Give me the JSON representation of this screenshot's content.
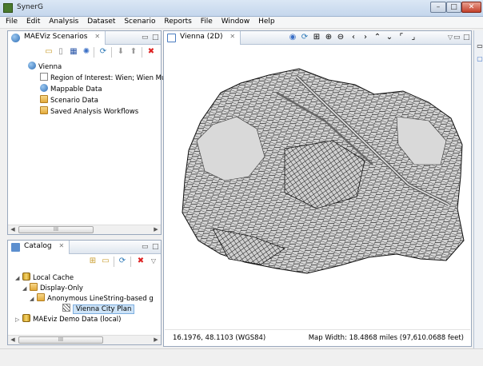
{
  "window": {
    "title": "SynerG"
  },
  "menu": [
    "File",
    "Edit",
    "Analysis",
    "Dataset",
    "Scenario",
    "Reports",
    "File",
    "Window",
    "Help"
  ],
  "scenarios_panel": {
    "tab_label": "MAEViz Scenarios",
    "tree": {
      "root": "Vienna",
      "children": [
        "Region of Interest: Wien; Wien Mu",
        "Mappable Data",
        "Scenario Data",
        "Saved Analysis Workflows"
      ]
    },
    "scroll_thumb": "III"
  },
  "catalog_panel": {
    "tab_label": "Catalog",
    "tree": {
      "local_cache": "Local Cache",
      "display_only": "Display-Only",
      "anonymous": "Anonymous LineString-based g",
      "city_plan": "Vienna City Plan",
      "demo": "MAEviz Demo Data (local)"
    },
    "scroll_thumb": "III"
  },
  "map_panel": {
    "tab_label": "Vienna (2D)",
    "coords": "16.1976, 48.1103 (WGS84)",
    "map_width": "Map Width: 18.4868 miles (97,610.0688 feet)"
  },
  "colors": {
    "map_fill": "#d6d6d6",
    "map_lines": "#1e1e1e",
    "selection": "#cde3f7"
  }
}
